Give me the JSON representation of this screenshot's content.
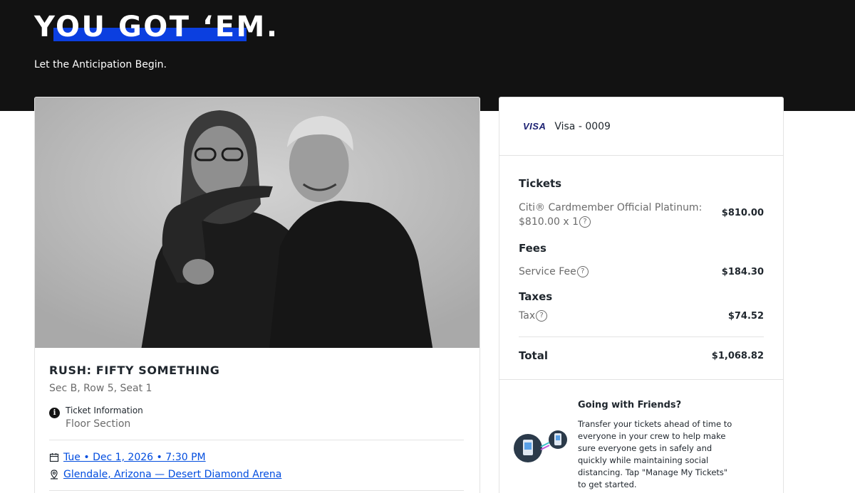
{
  "hero": {
    "title": "YOU GOT ‘EM.",
    "subtitle": "Let the Anticipation Begin."
  },
  "event": {
    "title": "RUSH: FIFTY SOMETHING",
    "seat": "Sec B, Row 5, Seat 1",
    "ticket_info_label": "Ticket Information",
    "ticket_info_value": "Floor Section",
    "date_link": "Tue • Dec 1, 2026 • 7:30 PM",
    "venue_link": "Glendale, Arizona — Desert Diamond Arena"
  },
  "payment": {
    "card_brand": "VISA",
    "card_label": "Visa - 0009"
  },
  "order": {
    "tickets_heading": "Tickets",
    "ticket_line_1": "Citi® Cardmember Official Platinum:",
    "ticket_line_2": "$810.00 x 1",
    "ticket_amount": "$810.00",
    "fees_heading": "Fees",
    "service_fee_label": "Service Fee",
    "service_fee_amount": "$184.30",
    "taxes_heading": "Taxes",
    "tax_label": "Tax",
    "tax_amount": "$74.52",
    "total_label": "Total",
    "total_amount": "$1,068.82"
  },
  "friends": {
    "title": "Going with Friends?",
    "text": "Transfer your tickets ahead of time to everyone in your crew to help make sure everyone gets in safely and quickly while maintaining social distancing. Tap \"Manage My Tickets\" to get started."
  },
  "colors": {
    "hero_bg": "#121212",
    "accent_blue": "#0b3fe0",
    "link_blue": "#024ddf",
    "visa_navy": "#1a1f71"
  }
}
